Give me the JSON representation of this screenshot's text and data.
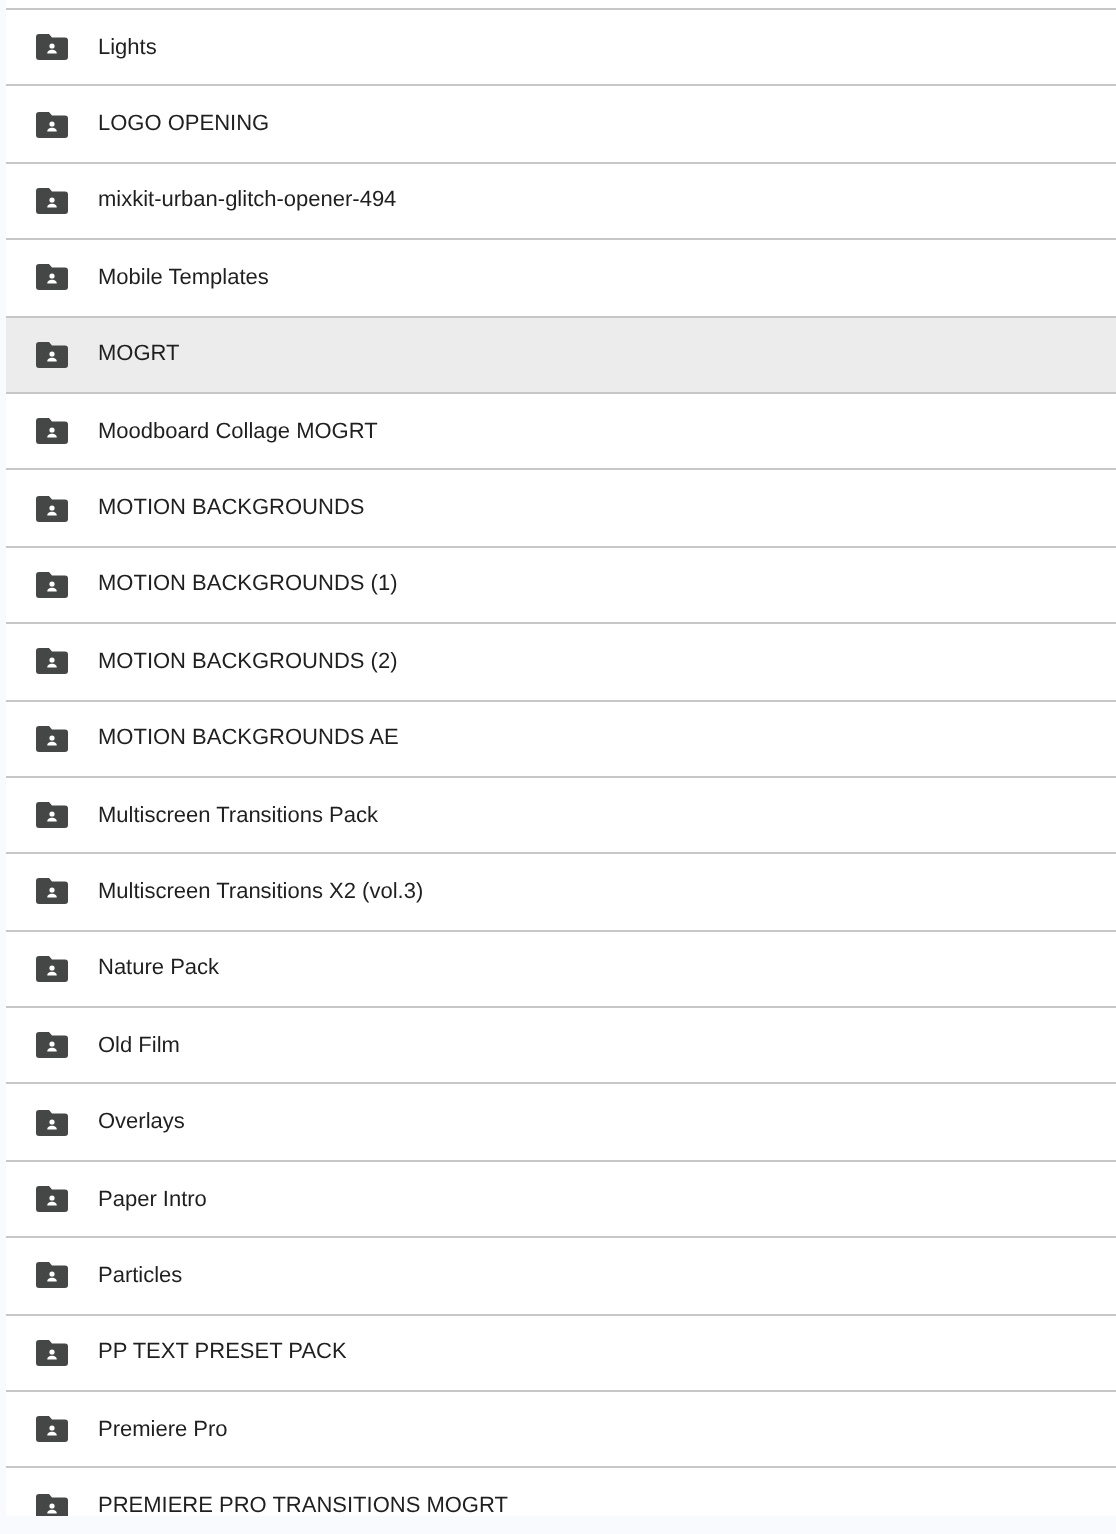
{
  "folders": [
    {
      "name": "Lights",
      "selected": false
    },
    {
      "name": "LOGO OPENING",
      "selected": false
    },
    {
      "name": "mixkit-urban-glitch-opener-494",
      "selected": false
    },
    {
      "name": "Mobile Templates",
      "selected": false
    },
    {
      "name": "MOGRT",
      "selected": true
    },
    {
      "name": "Moodboard Collage MOGRT",
      "selected": false
    },
    {
      "name": "MOTION BACKGROUNDS",
      "selected": false
    },
    {
      "name": "MOTION BACKGROUNDS (1)",
      "selected": false
    },
    {
      "name": "MOTION BACKGROUNDS (2)",
      "selected": false
    },
    {
      "name": "MOTION BACKGROUNDS AE",
      "selected": false
    },
    {
      "name": "Multiscreen Transitions Pack",
      "selected": false
    },
    {
      "name": "Multiscreen Transitions X2 (vol.3)",
      "selected": false
    },
    {
      "name": "Nature Pack",
      "selected": false
    },
    {
      "name": "Old Film",
      "selected": false
    },
    {
      "name": "Overlays",
      "selected": false
    },
    {
      "name": "Paper Intro",
      "selected": false
    },
    {
      "name": "Particles",
      "selected": false
    },
    {
      "name": "PP TEXT PRESET PACK",
      "selected": false
    },
    {
      "name": "Premiere Pro",
      "selected": false
    },
    {
      "name": "PREMIERE PRO TRANSITIONS MOGRT",
      "selected": false
    }
  ]
}
